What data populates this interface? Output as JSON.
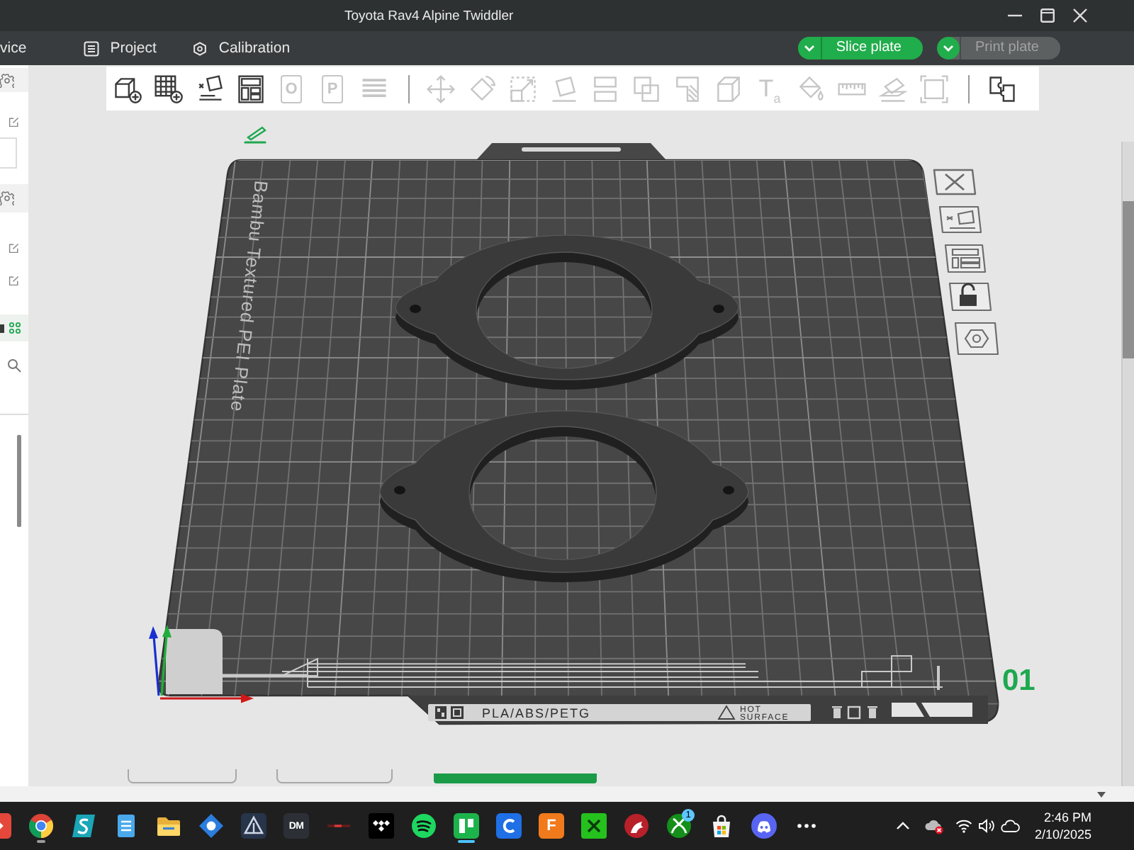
{
  "window": {
    "title": "Toyota Rav4 Alpine Twiddler"
  },
  "tabs": [
    {
      "label": "vice",
      "kind": "plain",
      "selected": false
    },
    {
      "label": "Project",
      "kind": "list",
      "selected": false
    },
    {
      "label": "Calibration",
      "kind": "hexagon",
      "selected": false
    }
  ],
  "actions": [
    {
      "label": "Slice plate",
      "disabled": false
    },
    {
      "label": "Print plate",
      "disabled": true
    }
  ],
  "toolbar": [
    {
      "kind": "add-cube",
      "disabled": false
    },
    {
      "kind": "add-grid",
      "disabled": false
    },
    {
      "kind": "auto-orient",
      "disabled": false
    },
    {
      "kind": "arrange",
      "disabled": false
    },
    {
      "kind": "page-glyph",
      "glyph": "O",
      "disabled": true
    },
    {
      "kind": "page-glyph",
      "glyph": "P",
      "disabled": true
    },
    {
      "kind": "layers",
      "disabled": true
    },
    {
      "kind": "divider"
    },
    {
      "kind": "move",
      "disabled": true
    },
    {
      "kind": "rotate",
      "disabled": true
    },
    {
      "kind": "scale",
      "disabled": true
    },
    {
      "kind": "lay-face",
      "disabled": true
    },
    {
      "kind": "cut",
      "disabled": true
    },
    {
      "kind": "boolean",
      "disabled": true
    },
    {
      "kind": "support",
      "disabled": true
    },
    {
      "kind": "cube",
      "disabled": true
    },
    {
      "kind": "text-glyph",
      "glyph": "T$_{a}$",
      "disabled": true
    },
    {
      "kind": "bucket",
      "disabled": true
    },
    {
      "kind": "ruler",
      "disabled": true
    },
    {
      "kind": "assembly",
      "disabled": true
    },
    {
      "kind": "fit",
      "disabled": true
    },
    {
      "kind": "divider"
    },
    {
      "kind": "puzzle",
      "disabled": false
    }
  ],
  "plate": {
    "name": "Bambu Textured PEI Plate",
    "number": "01",
    "filament": "PLA/ABS/PETG",
    "warning": [
      "HOT",
      "SURFACE"
    ]
  },
  "taskbar": {
    "apps": [
      {
        "kind": "arrow-tile",
        "running": false,
        "selected": false
      },
      {
        "kind": "browser",
        "running": true,
        "selected": false
      },
      {
        "kind": "slanted-tile",
        "running": false,
        "selected": false
      },
      {
        "kind": "notepad",
        "running": false,
        "selected": false
      },
      {
        "kind": "folder",
        "running": false,
        "selected": false
      },
      {
        "kind": "diamond",
        "running": false,
        "selected": false
      },
      {
        "kind": "triangle-tile",
        "running": false,
        "selected": false
      },
      {
        "kind": "dm-tile",
        "glyph": "DM",
        "running": false,
        "selected": false
      },
      {
        "kind": "dash",
        "running": false,
        "selected": false
      },
      {
        "kind": "dots-tile",
        "running": false,
        "selected": false
      },
      {
        "kind": "waves-circle",
        "running": false,
        "selected": false
      },
      {
        "kind": "bars-tile",
        "running": true,
        "selected": true
      },
      {
        "kind": "arc-tile",
        "running": false,
        "selected": false
      },
      {
        "kind": "f-tile",
        "glyph": "F",
        "running": false,
        "selected": false
      },
      {
        "kind": "x-tile",
        "running": false,
        "selected": false
      },
      {
        "kind": "dragon",
        "running": false,
        "selected": false
      },
      {
        "kind": "crossed-circle",
        "badge": "1",
        "running": false,
        "selected": false
      },
      {
        "kind": "bag",
        "running": false,
        "selected": false
      },
      {
        "kind": "chat-face",
        "running": false,
        "selected": false
      },
      {
        "kind": "more",
        "running": false,
        "selected": false
      }
    ],
    "time": "2:46 PM",
    "date": "2/10/2025"
  }
}
